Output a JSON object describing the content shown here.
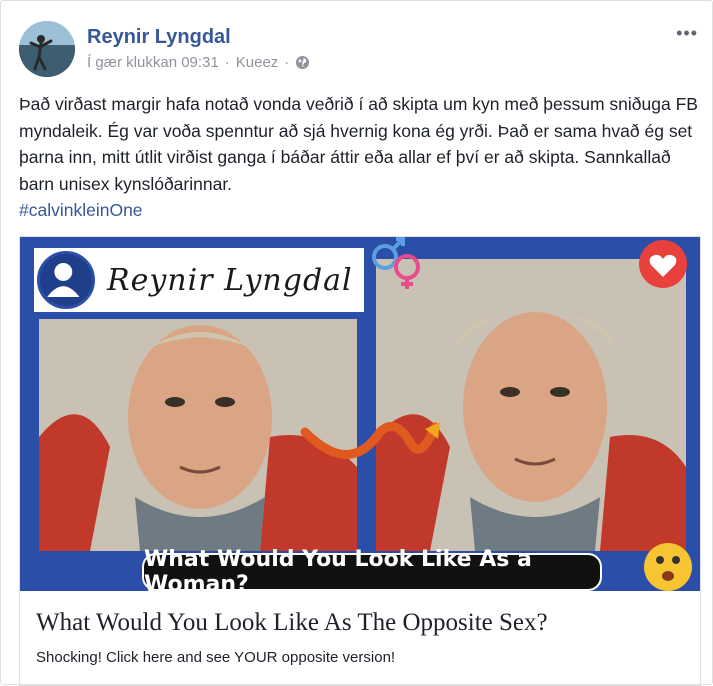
{
  "post": {
    "author": "Reynir Lyngdal",
    "time": "Í gær klukkan 09:31",
    "separator": "·",
    "via": "Kueez",
    "separator2": "·",
    "privacy_icon": "globe-icon",
    "more_label": "•••",
    "text": "Það virðast margir hafa notað vonda veðrið í að skipta um kyn með þessum sniðuga FB myndaleik. Ég var voða spenntur að sjá hvernig kona ég yrði. Það er sama hvað ég set þarna inn, mitt útlit virðist ganga í báðar áttir eða allar ef því er að skipta. Sannkallað barn unisex kynslóðarinnar.",
    "hashtag": "#calvinkleinOne"
  },
  "share": {
    "image_name_label": "Reynir Lyngdal",
    "image_caption": "What Would You Look Like As a Woman?",
    "title": "What Would You Look Like As The Opposite Sex?",
    "description": "Shocking! Click here and see YOUR opposite version!"
  },
  "colors": {
    "link": "#365899",
    "meta": "#90949c",
    "image_bg": "#2b4fa8",
    "heart": "#e8413b"
  }
}
